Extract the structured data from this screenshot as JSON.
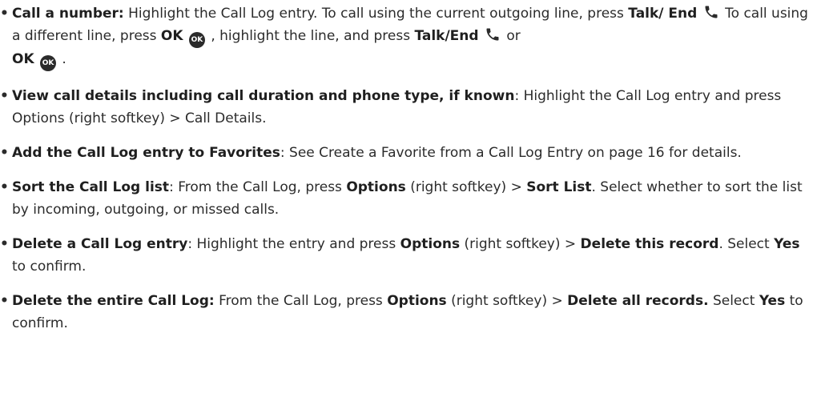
{
  "items": [
    {
      "title": "Call a number:",
      "p1": " Highlight the Call Log entry. To call using the current outgoing line, press ",
      "b1": "Talk/ End",
      "p2": " To call using a different line, press ",
      "b2": "OK",
      "p3": " , highlight the line, and press ",
      "b3": "Talk/End",
      "p4": " or ",
      "b4": "OK",
      "p5": " ."
    },
    {
      "title": "View call details including call duration and phone type, if known",
      "p1": ": Highlight the Call Log entry and press Options (right softkey) > Call Details."
    },
    {
      "title": "Add the Call Log entry to Favorites",
      "p1": ": See Create a Favorite from a Call Log Entry on page 16 for details."
    },
    {
      "title": "Sort the Call Log list",
      "p1": ": From the Call Log, press ",
      "b1": "Options",
      "p2": " (right softkey) > ",
      "b2": "Sort List",
      "p3": ". Select whether to sort the list by incoming, outgoing, or missed calls."
    },
    {
      "title": "Delete a Call Log entry",
      "p1": ": Highlight the entry and press ",
      "b1": "Options",
      "p2": " (right softkey) > ",
      "b2": "Delete this record",
      "p3": ". Select ",
      "b3": "Yes",
      "p4": " to confirm."
    },
    {
      "title": "Delete the entire Call Log:",
      "p1": " From the Call Log, press ",
      "b1": "Options",
      "p2": " (right softkey) > ",
      "b2": "Delete all records.",
      "p3": " Select ",
      "b3": "Yes",
      "p4": " to confirm."
    }
  ],
  "icons": {
    "ok_label": "OK",
    "phone": "phone-handset-icon",
    "ok": "ok-button-icon"
  },
  "bullet_symbol": "•"
}
